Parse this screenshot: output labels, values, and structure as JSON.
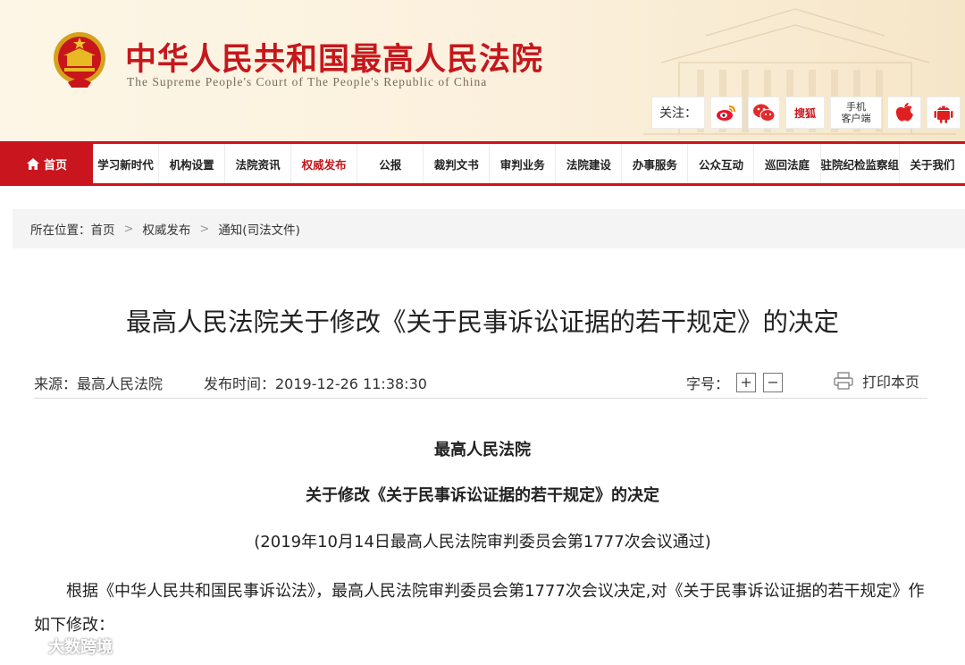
{
  "header": {
    "title": "中华人民共和国最高人民法院",
    "subtitle": "The Supreme People's Court of The People's Republic of China",
    "follow_label": "关注：",
    "sohu_label": "搜狐",
    "mobile_label_line1": "手机",
    "mobile_label_line2": "客户端"
  },
  "nav": {
    "home_label": "首页",
    "items": [
      {
        "label": "学习新时代"
      },
      {
        "label": "机构设置"
      },
      {
        "label": "法院资讯"
      },
      {
        "label": "权威发布"
      },
      {
        "label": "公报"
      },
      {
        "label": "裁判文书"
      },
      {
        "label": "审判业务"
      },
      {
        "label": "法院建设"
      },
      {
        "label": "办事服务"
      },
      {
        "label": "公众互动"
      },
      {
        "label": "巡回法庭"
      },
      {
        "label": "驻院纪检监察组"
      },
      {
        "label": "关于我们"
      }
    ],
    "active_index": 3
  },
  "breadcrumb": {
    "prefix": "所在位置：",
    "items": [
      "首页",
      "权威发布",
      "通知(司法文件)"
    ]
  },
  "article": {
    "title": "最高人民法院关于修改《关于民事诉讼证据的若干规定》的决定",
    "source": "来源：最高人民法院",
    "publish_time": "发布时间：2019-12-26 11:38:30",
    "font_size_label": "字号：",
    "font_plus": "+",
    "font_minus": "−",
    "print_label": "打印本页",
    "body_heading1": "最高人民法院",
    "body_heading2": "关于修改《关于民事诉讼证据的若干规定》的决定",
    "body_note": "(2019年10月14日最高人民法院审判委员会第1777次会议通过)",
    "body_paragraph": "根据《中华人民共和国民事诉讼法》，最高人民法院审判委员会第1777次会议决定,对《关于民事诉讼证据的若干规定》作如下修改："
  },
  "watermark": {
    "text": "大数跨境"
  },
  "colors": {
    "brand_red": "#c5171c",
    "nav_red": "#d0121b",
    "header_bg": "#fbf0dc"
  }
}
